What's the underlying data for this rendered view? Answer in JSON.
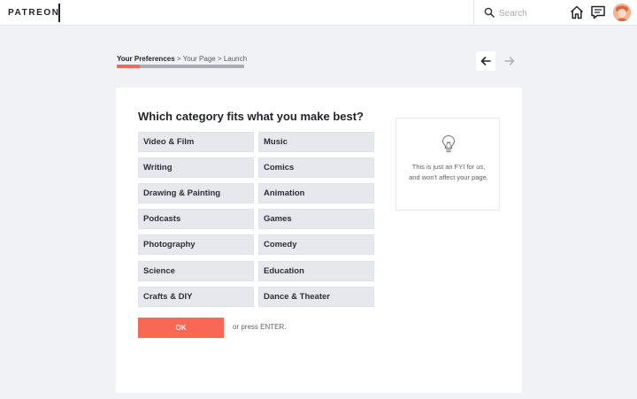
{
  "header": {
    "logo": "PATREON",
    "search_placeholder": "Search",
    "icons": [
      "search-icon",
      "home-icon",
      "message-icon"
    ]
  },
  "breadcrumb": {
    "active": "Your Preferences",
    "rest": " > Your Page > Launch"
  },
  "progress": {
    "fraction": 0.18
  },
  "question": "Which category fits what you make best?",
  "categories": [
    "Video & Film",
    "Music",
    "Writing",
    "Comics",
    "Drawing & Painting",
    "Animation",
    "Podcasts",
    "Games",
    "Photography",
    "Comedy",
    "Science",
    "Education",
    "Crafts & DIY",
    "Dance & Theater"
  ],
  "ok_label": "OK",
  "enter_hint": "or press ENTER.",
  "fyi": {
    "icon": "lightbulb-icon",
    "text": "This is just an FYI for us, and won't affect your page."
  },
  "colors": {
    "accent": "#f96854",
    "option_bg": "#e6e8ee",
    "page_bg": "#f1f2f5"
  }
}
